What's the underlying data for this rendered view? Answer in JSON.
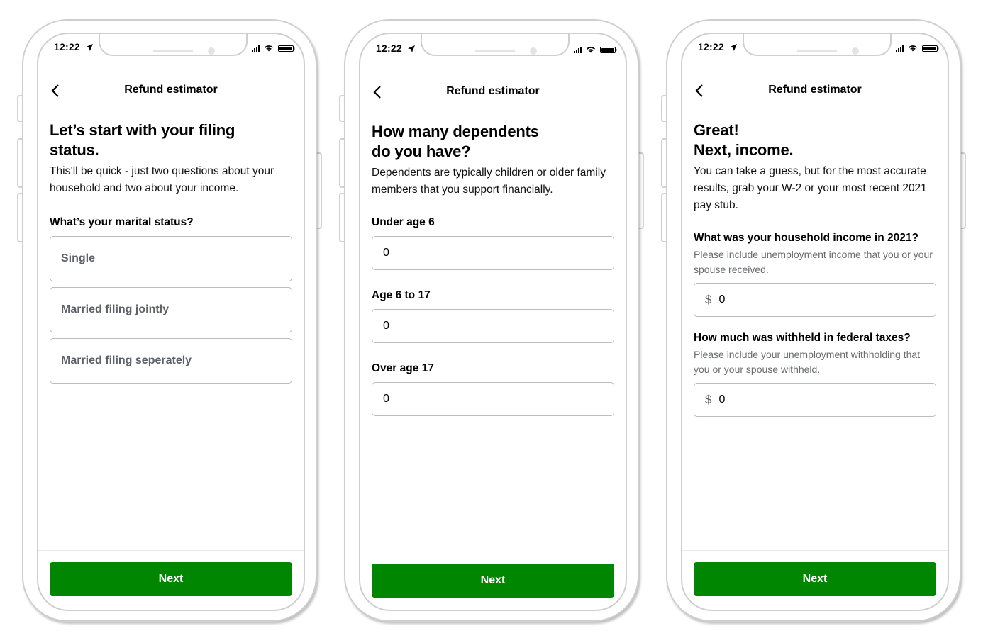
{
  "brand_color": "#008600",
  "status_bar": {
    "time": "12:22"
  },
  "screens": [
    {
      "nav_title": "Refund estimator",
      "heading": "Let’s start with your filing status.",
      "lead": "This’ll be quick - just two questions about your household and two about your income.",
      "question": "What’s your marital status?",
      "options": [
        "Single",
        "Married filing jointly",
        "Married filing seperately"
      ],
      "next_label": "Next"
    },
    {
      "nav_title": "Refund estimator",
      "heading_line1": "How many dependents",
      "heading_line2": "do you have?",
      "lead": "Dependents are typically children or older family members that you support financially.",
      "fields": [
        {
          "label": "Under age 6",
          "value": "0"
        },
        {
          "label": "Age 6 to 17",
          "value": "0"
        },
        {
          "label": "Over age 17",
          "value": "0"
        }
      ],
      "next_label": "Next"
    },
    {
      "nav_title": "Refund estimator",
      "heading_line1": "Great!",
      "heading_line2": "Next, income.",
      "lead": "You can take a guess, but for the most accurate results, grab your W-2 or your most recent 2021 pay stub.",
      "fields": [
        {
          "label": "What was your household income in 2021?",
          "hint": "Please include unemployment income that you or your spouse received.",
          "prefix": "$",
          "value": "0"
        },
        {
          "label": "How much was withheld in federal taxes?",
          "hint": "Please include your unemployment withholding that you or your spouse withheld.",
          "prefix": "$",
          "value": "0"
        }
      ],
      "next_label": "Next"
    }
  ]
}
